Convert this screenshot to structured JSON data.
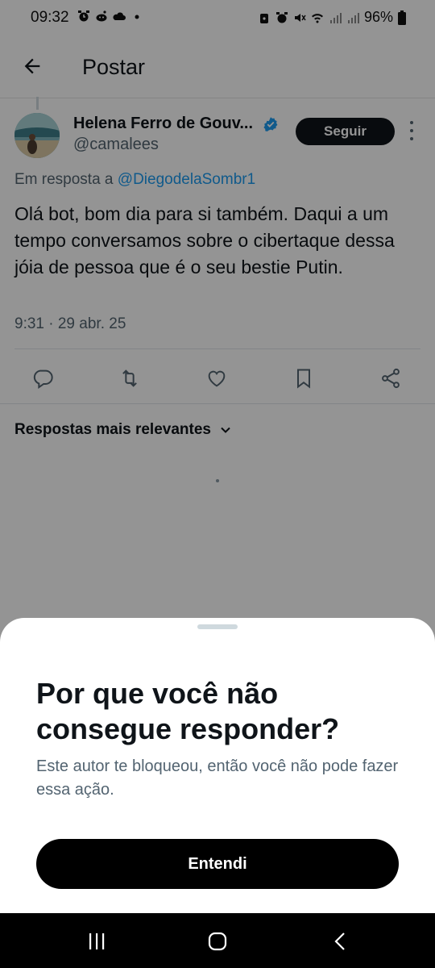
{
  "status_bar": {
    "time": "09:32",
    "battery": "96%"
  },
  "header": {
    "title": "Postar"
  },
  "tweet": {
    "author_name": "Helena Ferro de Gouv...",
    "author_handle": "@camalees",
    "follow_label": "Seguir",
    "reply_prefix": "Em resposta a",
    "reply_mention": "@DiegodelaSombr1",
    "text": "Olá bot, bom dia para si também. Daqui a um tempo conversamos sobre o cibertaque dessa jóia de pessoa que é o seu bestie Putin.",
    "timestamp": "9:31 · 29 abr. 25",
    "actions": [
      "reply-icon",
      "retweet-icon",
      "like-icon",
      "bookmark-icon",
      "share-icon"
    ]
  },
  "replies": {
    "sort_label": "Respostas mais relevantes"
  },
  "sheet": {
    "title": "Por que você não consegue responder?",
    "body": "Este autor te bloqueou, então você não pode fazer essa ação.",
    "button_label": "Entendi"
  },
  "colors": {
    "accent": "#1d9bf0",
    "text_primary": "#0f1419",
    "text_secondary": "#536471",
    "overlay": "rgba(0,0,0,0.42)"
  }
}
